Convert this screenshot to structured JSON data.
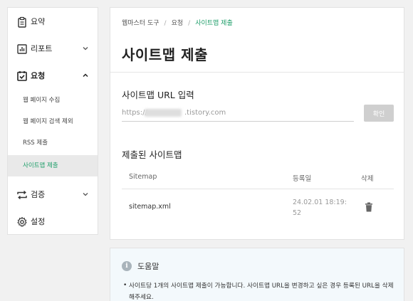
{
  "sidebar": {
    "summary_label": "요약",
    "report_label": "리포트",
    "request_label": "요청",
    "sub_items": [
      "웹 페이지 수집",
      "웹 페이지 검색 제외",
      "RSS 제출",
      "사이트맵 제출"
    ],
    "verify_label": "검증",
    "settings_label": "설정"
  },
  "breadcrumb": {
    "items": [
      "웹마스터 도구",
      "요청",
      "사이트맵 제출"
    ]
  },
  "page_title": "사이트맵 제출",
  "url_section": {
    "title": "사이트맵 URL 입력",
    "placeholder": "https://",
    "suffix": ".tistory.com",
    "button_label": "확인"
  },
  "submitted_section": {
    "title": "제출된 사이트맵",
    "columns": [
      "Sitemap",
      "등록일",
      "삭제"
    ],
    "rows": [
      {
        "sitemap": "sitemap.xml",
        "date": "24.02.01 18:19:52"
      }
    ]
  },
  "help": {
    "icon": "i",
    "title": "도움말",
    "bullet": "•",
    "text": "사이트당 1개의 사이트맵 제출이 가능합니다. 사이트맵 URL을 변경하고 싶은 경우 등록된 URL을 삭제해주세요."
  }
}
